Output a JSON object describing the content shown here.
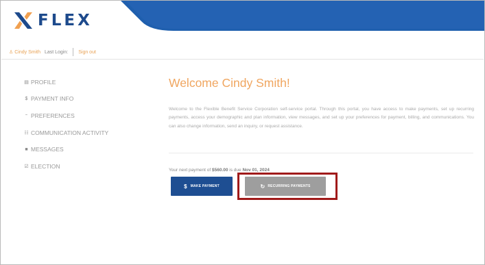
{
  "app": {
    "logo_text": "FLEX"
  },
  "userbar": {
    "user_name": "Cindy Smith",
    "last_login_label": "Last Login:",
    "sign_out_label": "Sign out"
  },
  "sidebar": {
    "items": [
      {
        "label": "PROFILE",
        "icon": "id-card-icon",
        "glyph": "▤"
      },
      {
        "label": "PAYMENT INFO",
        "icon": "dollar-icon",
        "glyph": "$"
      },
      {
        "label": "PREFERENCES",
        "icon": "sliders-icon",
        "glyph": "⁼"
      },
      {
        "label": "COMMUNICATION ACTIVITY",
        "icon": "list-icon",
        "glyph": "☷"
      },
      {
        "label": "MESSAGES",
        "icon": "message-icon",
        "glyph": "■"
      },
      {
        "label": "ELECTION",
        "icon": "checklist-icon",
        "glyph": "☑"
      }
    ]
  },
  "main": {
    "welcome_title": "Welcome Cindy Smith!",
    "intro_text": "Welcome to the Flexible Benefit Service Corporation self-service portal. Through this portal, you have access to make payments, set up recurring payments, access your demographic and plan information, view messages, and set up your preferences for payment, billing, and communications. You can also change information, send an inquiry, or request assistance.",
    "next_payment_prefix": "Your next payment of ",
    "next_payment_amount": "$560.00",
    "next_payment_middle": " is due ",
    "next_payment_date": "Nov 01, 2024",
    "make_payment_label": "MAKE PAYMENT",
    "recurring_payments_label": "RECURRING PAYMENTS"
  },
  "colors": {
    "brand_blue": "#1e4e92",
    "accent_orange": "#f0a660",
    "highlight_red": "#a01a1a",
    "button_gray": "#9e9e9e"
  }
}
